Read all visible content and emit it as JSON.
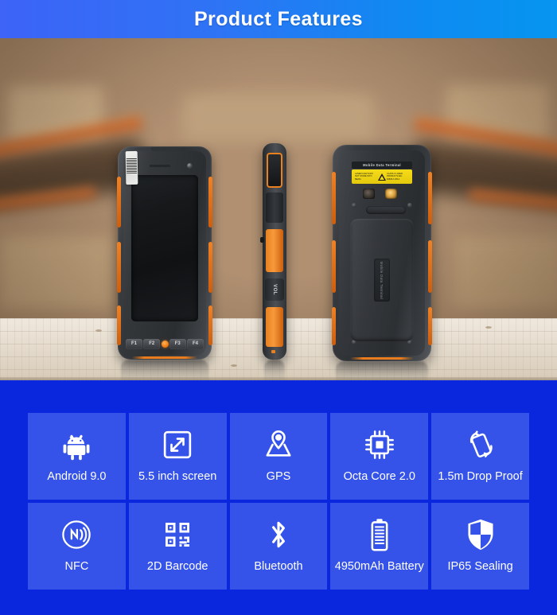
{
  "header": {
    "title": "Product Features",
    "gradient_from": "#3d63f7",
    "gradient_to": "#0695f0"
  },
  "hero": {
    "scene": "blurred-warehouse-with-wooden-table",
    "devices": [
      {
        "view": "front",
        "function_keys": [
          "F1",
          "F2",
          "F3",
          "F4"
        ],
        "scan_button": "scan-key",
        "body_color": "#2e3134",
        "accent_color": "#e97c1c"
      },
      {
        "view": "side",
        "vol_label": "VOL",
        "body_color": "#3c4044",
        "accent_color": "#e8801f"
      },
      {
        "view": "back",
        "model_label": "Mobile Data Terminal",
        "battery_door_label": "Mobile Data Terminal",
        "warning_label": {
          "color": "#f5dc19",
          "left_text": "LASER LIGHT\\nDO NOT STARE INTO BEAM",
          "right_text": "CLASS 2 LASER PRODUCT\\nIEC 60825-1:2014"
        },
        "body_color": "#2c2f32",
        "accent_color": "#e97c1c"
      }
    ]
  },
  "features": {
    "background_color": "#0b27de",
    "tile_color": "#3553e8",
    "rows": [
      [
        {
          "icon": "android-icon",
          "label": "Android 9.0"
        },
        {
          "icon": "screen-size-icon",
          "label": "5.5 inch screen"
        },
        {
          "icon": "gps-icon",
          "label": "GPS"
        },
        {
          "icon": "cpu-icon",
          "label": "Octa Core 2.0"
        },
        {
          "icon": "drop-proof-icon",
          "label": "1.5m Drop Proof"
        }
      ],
      [
        {
          "icon": "nfc-icon",
          "label": "NFC"
        },
        {
          "icon": "qr-code-icon",
          "label": "2D Barcode"
        },
        {
          "icon": "bluetooth-icon",
          "label": "Bluetooth"
        },
        {
          "icon": "battery-icon",
          "label": "4950mAh Battery"
        },
        {
          "icon": "shield-icon",
          "label": "IP65 Sealing"
        }
      ]
    ]
  }
}
